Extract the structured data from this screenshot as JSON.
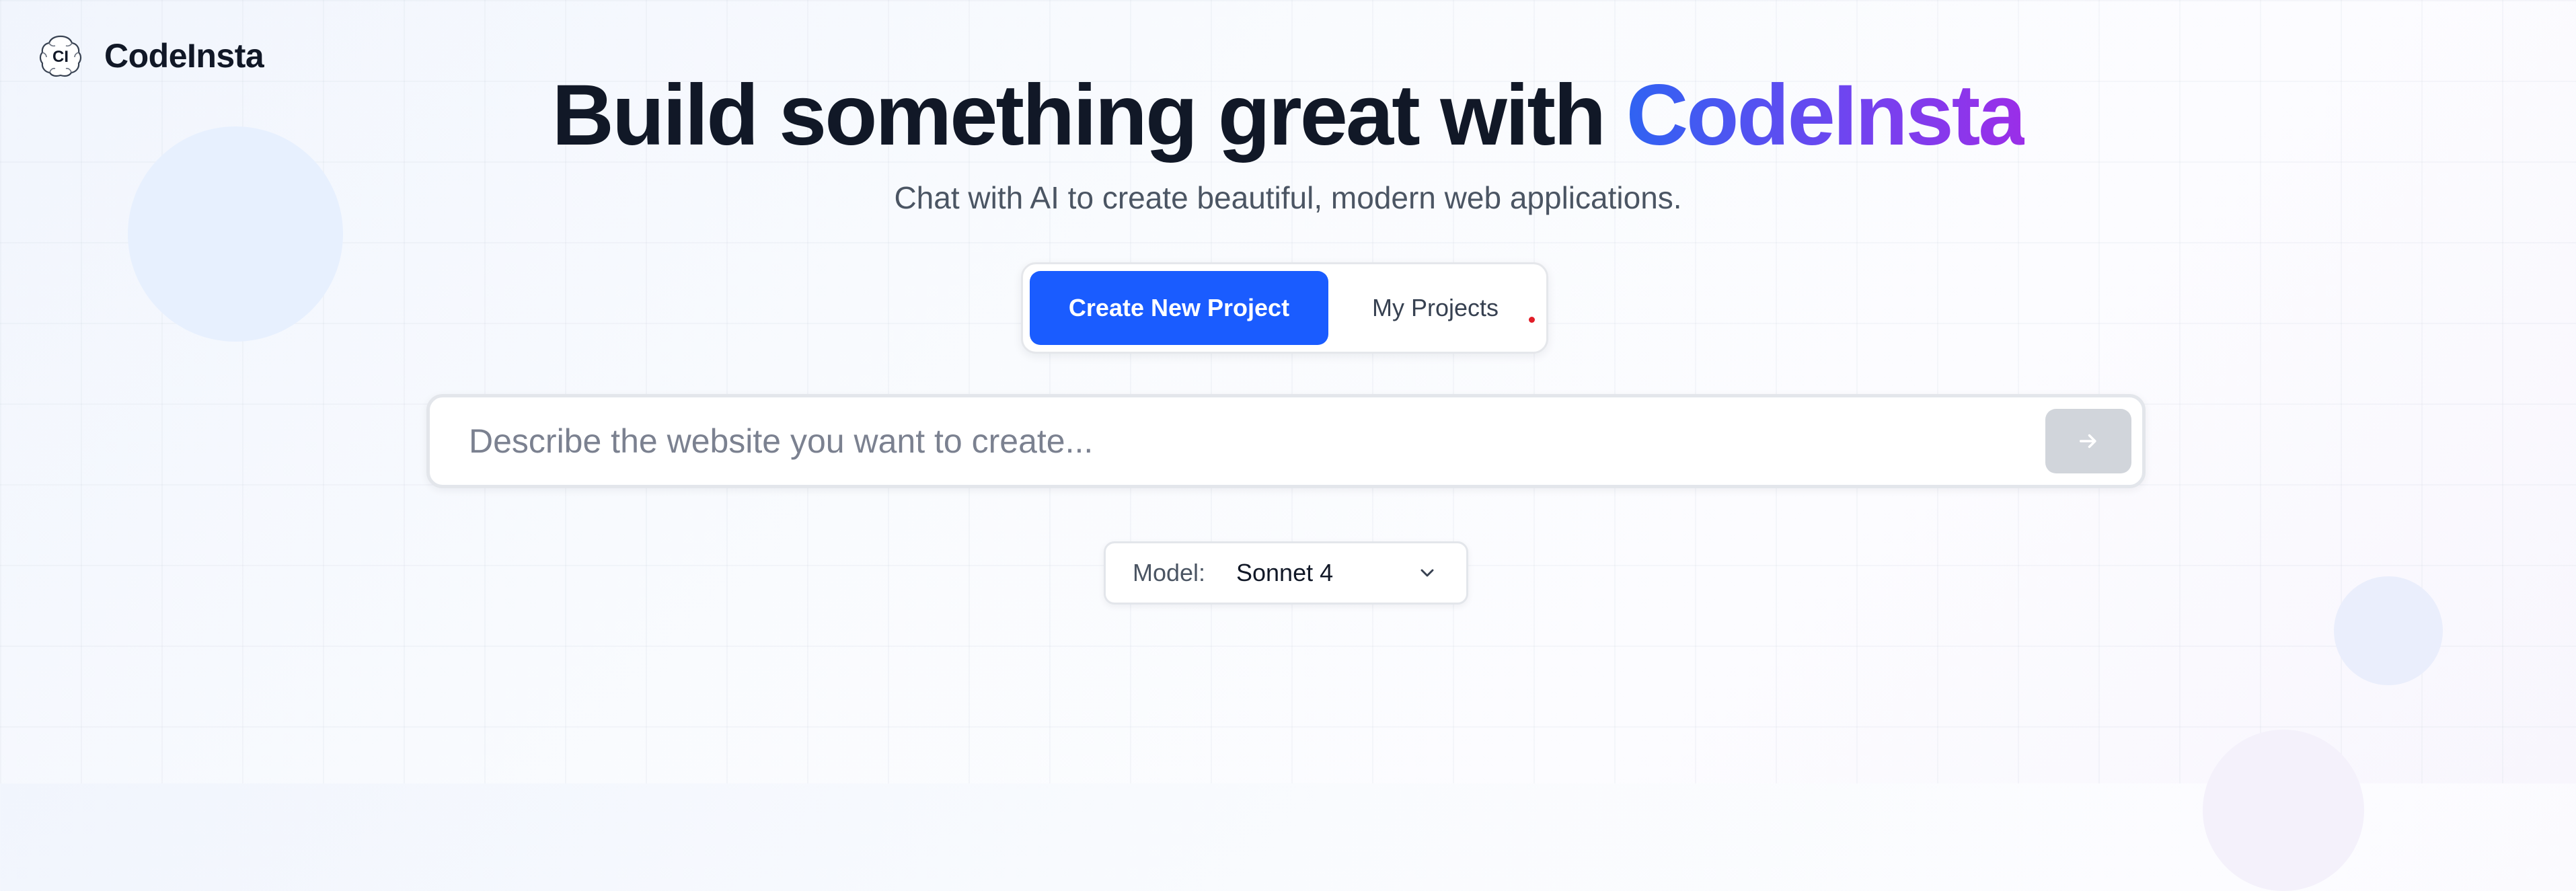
{
  "brand": {
    "logo_initials": "CI",
    "name": "CodeInsta"
  },
  "hero": {
    "headline_prefix": "Build something great with ",
    "headline_brand": "CodeInsta",
    "subtitle": "Chat with AI to create beautiful, modern web applications."
  },
  "tabs": {
    "active": "Create New Project",
    "items": [
      {
        "label": "Create New Project",
        "active": true
      },
      {
        "label": "My Projects",
        "active": false
      }
    ]
  },
  "prompt": {
    "value": "",
    "placeholder": "Describe the website you want to create...",
    "send_icon": "arrow-right-icon",
    "send_enabled": false
  },
  "model": {
    "label": "Model:",
    "selected": "Sonnet 4",
    "icon": "chevron-down-icon"
  },
  "colors": {
    "primary": "#1a5cff",
    "brand_gradient_start": "#2f63f2",
    "brand_gradient_end": "#9b2ee8",
    "heading": "#111827",
    "muted": "#4b5563",
    "send_disabled": "#d1d5db",
    "notification_dot": "#e11d28"
  }
}
